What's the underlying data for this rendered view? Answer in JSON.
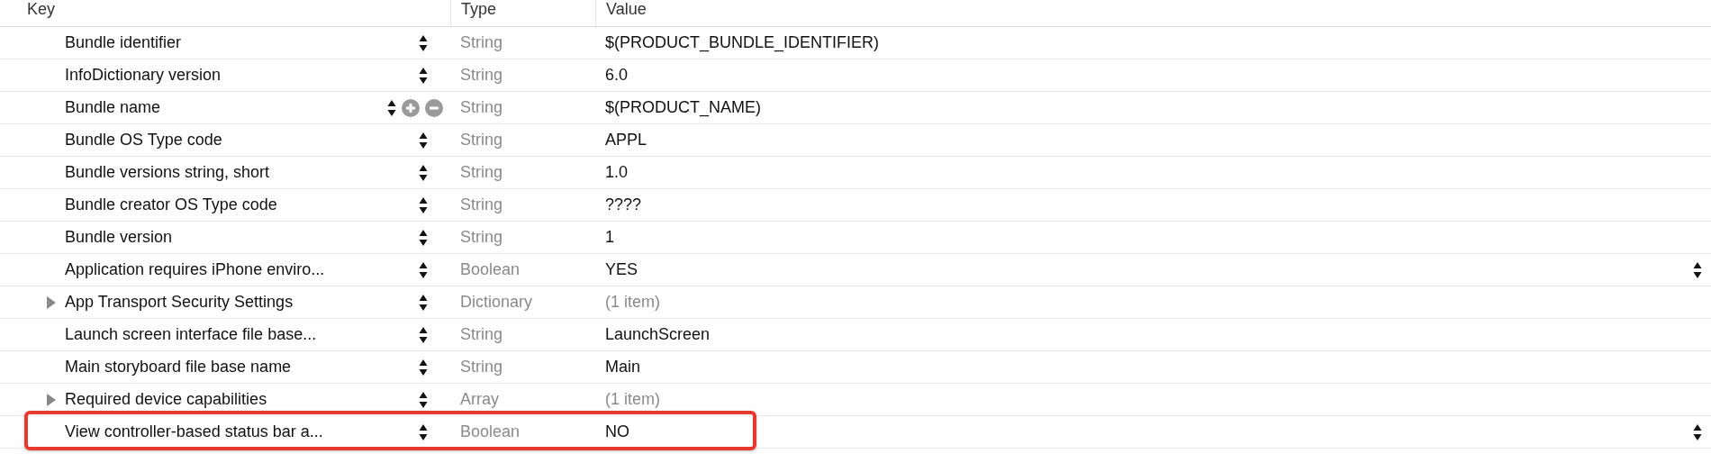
{
  "columns": [
    "Key",
    "Type",
    "Value"
  ],
  "rows": [
    {
      "key": "Bundle identifier",
      "type": "String",
      "value": "$(PRODUCT_BUNDLE_IDENTIFIER)",
      "kind": "string",
      "hovered": false,
      "highlighted": false
    },
    {
      "key": "InfoDictionary version",
      "type": "String",
      "value": "6.0",
      "kind": "string",
      "hovered": false,
      "highlighted": false
    },
    {
      "key": "Bundle name",
      "type": "String",
      "value": "$(PRODUCT_NAME)",
      "kind": "string",
      "hovered": true,
      "highlighted": false
    },
    {
      "key": "Bundle OS Type code",
      "type": "String",
      "value": "APPL",
      "kind": "string",
      "hovered": false,
      "highlighted": false
    },
    {
      "key": "Bundle versions string, short",
      "type": "String",
      "value": "1.0",
      "kind": "string",
      "hovered": false,
      "highlighted": false
    },
    {
      "key": "Bundle creator OS Type code",
      "type": "String",
      "value": "????",
      "kind": "string",
      "hovered": false,
      "highlighted": false
    },
    {
      "key": "Bundle version",
      "type": "String",
      "value": "1",
      "kind": "string",
      "hovered": false,
      "highlighted": false
    },
    {
      "key": "Application requires iPhone enviro...",
      "type": "Boolean",
      "value": "YES",
      "kind": "boolean",
      "hovered": false,
      "highlighted": false
    },
    {
      "key": "App Transport Security Settings",
      "type": "Dictionary",
      "value": "(1 item)",
      "kind": "collection",
      "expanded": false,
      "hovered": false,
      "highlighted": false
    },
    {
      "key": "Launch screen interface file base...",
      "type": "String",
      "value": "LaunchScreen",
      "kind": "string",
      "hovered": false,
      "highlighted": false
    },
    {
      "key": "Main storyboard file base name",
      "type": "String",
      "value": "Main",
      "kind": "string",
      "hovered": false,
      "highlighted": false
    },
    {
      "key": "Required device capabilities",
      "type": "Array",
      "value": "(1 item)",
      "kind": "collection",
      "expanded": false,
      "hovered": false,
      "highlighted": false
    },
    {
      "key": "View controller-based status bar a...",
      "type": "Boolean",
      "value": "NO",
      "kind": "boolean",
      "hovered": false,
      "highlighted": true
    }
  ]
}
